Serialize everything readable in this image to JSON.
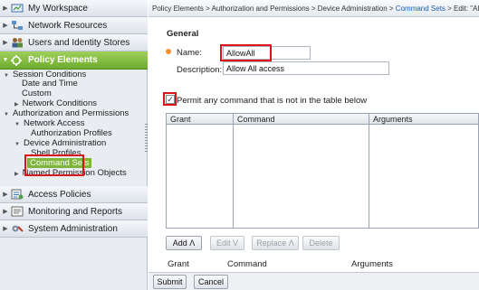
{
  "sidebar": {
    "sections": [
      {
        "label": "My Workspace",
        "icon": "workspace-icon"
      },
      {
        "label": "Network Resources",
        "icon": "network-icon"
      },
      {
        "label": "Users and Identity Stores",
        "icon": "users-icon"
      },
      {
        "label": "Policy Elements",
        "icon": "policy-elements-icon"
      }
    ],
    "tree": [
      "Session Conditions",
      "Date and Time",
      "Custom",
      "Network Conditions",
      "Authorization and Permissions",
      "Network Access",
      "Authorization Profiles",
      "Device Administration",
      "Shell Profiles",
      "Command Sets",
      "Named Permission Objects"
    ],
    "bottom_sections": [
      {
        "label": "Access Policies",
        "icon": "access-policies-icon"
      },
      {
        "label": "Monitoring and Reports",
        "icon": "monitoring-icon"
      },
      {
        "label": "System Administration",
        "icon": "system-admin-icon"
      }
    ],
    "colors": {
      "active": "#7db63a",
      "highlight": "#d9141b"
    }
  },
  "breadcrumb": {
    "part1": "Policy Elements > Authorization and Permissions > Device Administration > ",
    "current": "Command Sets",
    "part2": " > Edit: \"AllowAll\""
  },
  "form": {
    "section_title": "General",
    "name_label": "Name:",
    "name_value": "AllowAll",
    "description_label": "Description:",
    "description_value": "Allow All access",
    "permit_checked": true,
    "permit_label": "Permit any command that is not in the table below"
  },
  "grid": {
    "columns": [
      "Grant",
      "Command",
      "Arguments"
    ]
  },
  "buttons": {
    "add": "Add Λ",
    "edit": "Edit V",
    "replace": "Replace Λ",
    "delete": "Delete"
  },
  "lower_headers": [
    "Grant",
    "Command",
    "Arguments"
  ],
  "footer": {
    "submit": "Submit",
    "cancel": "Cancel"
  }
}
